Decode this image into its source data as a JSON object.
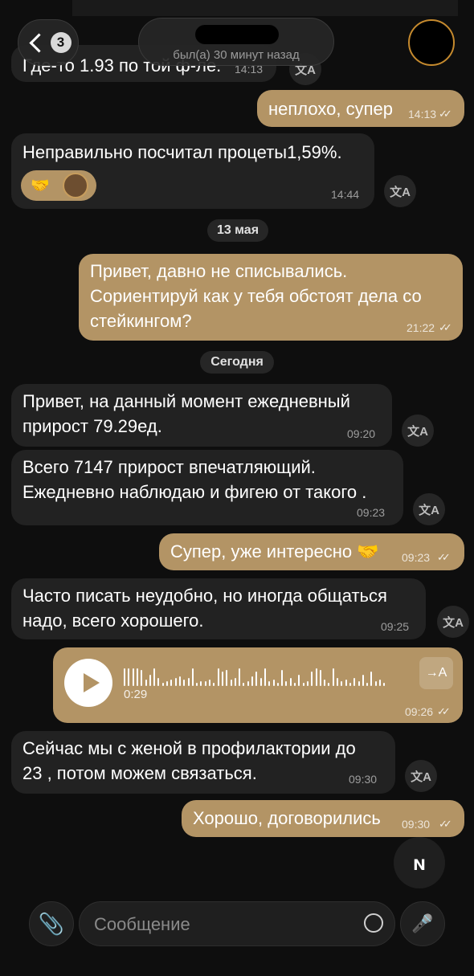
{
  "header": {
    "back_badge": "3",
    "status": "был(а) 30 минут назад"
  },
  "messages": [
    {
      "id": "m0",
      "dir": "in",
      "text": "Где-то 1.93 по той ф-ле.",
      "time": "14:13",
      "partial": true
    },
    {
      "id": "m1",
      "dir": "out",
      "text": "неплохо, супер",
      "time": "14:13"
    },
    {
      "id": "m2",
      "dir": "in",
      "text": "Неправильно посчитал процеты1,59%.",
      "time": "14:44",
      "reaction": "🤝"
    },
    {
      "id": "d1",
      "type": "date",
      "text": "13 мая"
    },
    {
      "id": "m3",
      "dir": "out",
      "lines": [
        "Привет, давно не списывались.",
        "Сориентируй как у тебя обстоят дела со",
        "стейкингом?"
      ],
      "time": "21:22"
    },
    {
      "id": "d2",
      "type": "date",
      "text": "Сегодня"
    },
    {
      "id": "m4",
      "dir": "in",
      "lines": [
        "Привет, на данный момент ежедневный",
        "прирост 79.29ед."
      ],
      "time": "09:20"
    },
    {
      "id": "m5",
      "dir": "in",
      "lines": [
        "Всего 7147 прирост впечатляющий.",
        "Ежедневно наблюдаю и фигею от такого ."
      ],
      "time": "09:23"
    },
    {
      "id": "m6",
      "dir": "out",
      "text": "Супер, уже интересно 🤝",
      "time": "09:23"
    },
    {
      "id": "m7",
      "dir": "in",
      "lines": [
        "Часто писать неудобно, но иногда общаться",
        "надо, всего хорошего."
      ],
      "time": "09:25"
    },
    {
      "id": "m8",
      "dir": "out",
      "type": "voice",
      "duration": "0:29",
      "time": "09:26",
      "transcribe": "→A"
    },
    {
      "id": "m9",
      "dir": "in",
      "lines": [
        "Сейчас мы с женой в профилактории до",
        "23 , потом можем связаться."
      ],
      "time": "09:30"
    },
    {
      "id": "m10",
      "dir": "out",
      "text": "Хорошо, договорились",
      "time": "09:30"
    }
  ],
  "icons": {
    "translate": "文A",
    "read": "✓✓",
    "floating": "ɴ"
  },
  "composer": {
    "placeholder": "Сообщение"
  },
  "colors": {
    "outgoing": "#b39465",
    "incoming": "#222222",
    "background": "#0e0e0e"
  }
}
